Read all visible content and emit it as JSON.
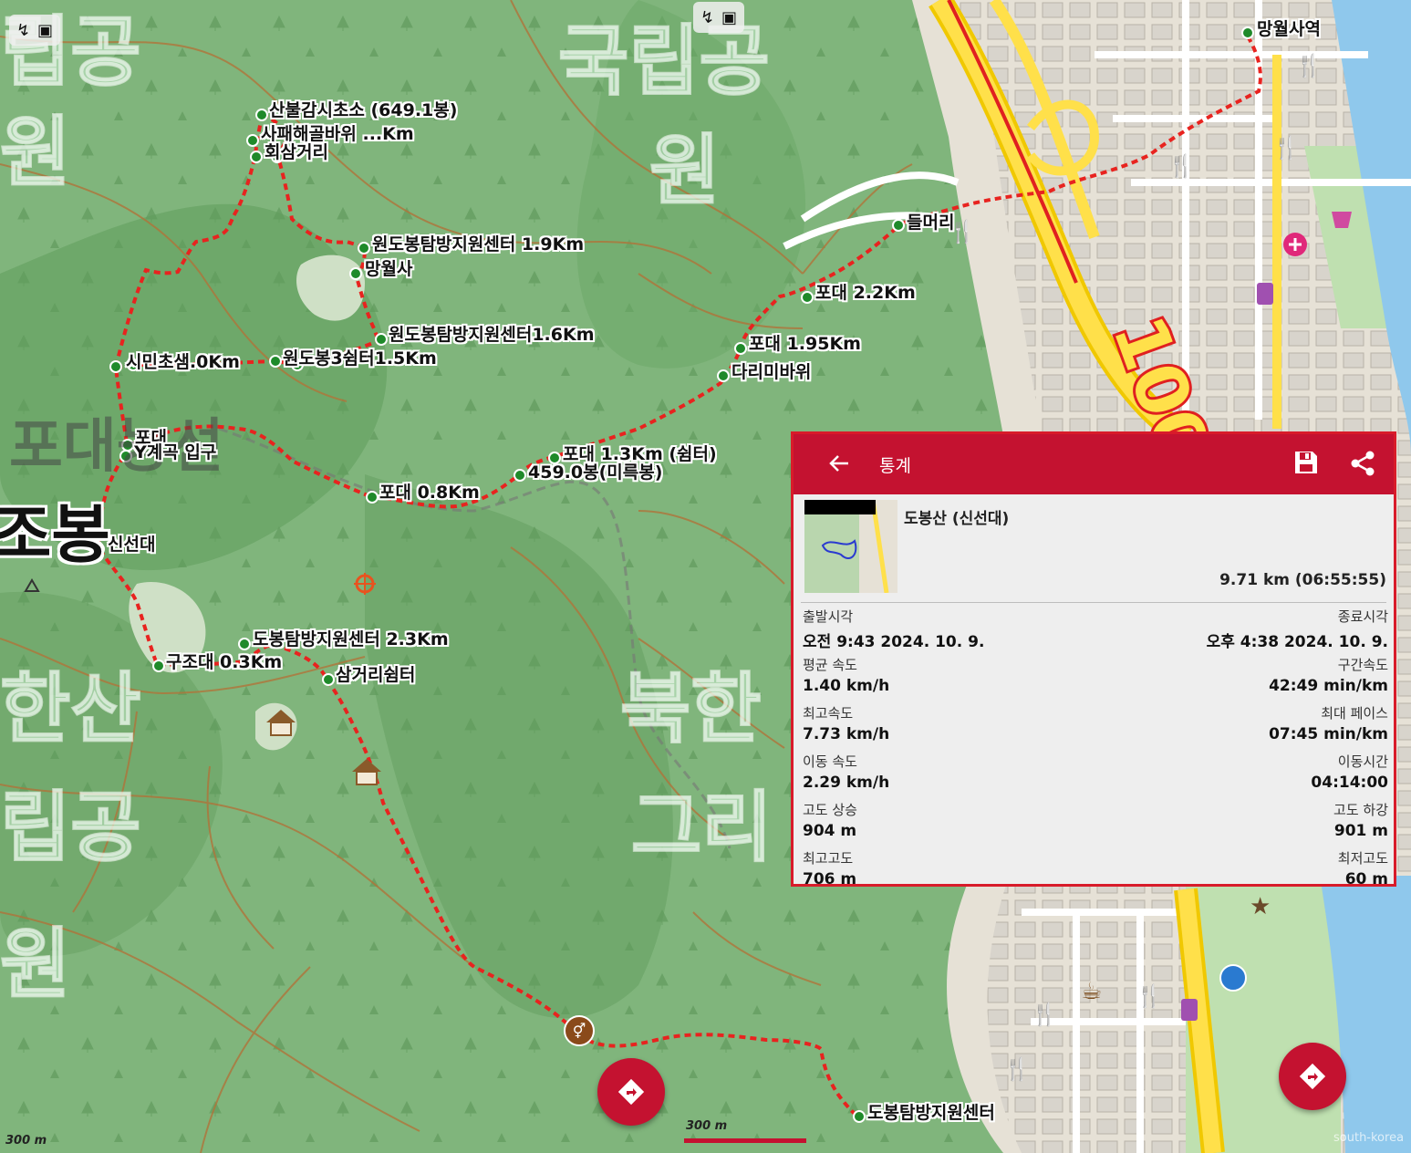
{
  "map": {
    "park_labels": [
      "국립공원",
      "립공",
      "원",
      "국립공",
      "원",
      "한산",
      "립공",
      "원",
      "북한",
      "그리"
    ],
    "area_labels": [
      "포대능선"
    ],
    "peak_labels": [
      "조봉"
    ],
    "road_number": "100",
    "scale_left": "300 m",
    "scale_center": "300 m",
    "attribution": "south-korea"
  },
  "waypoints": [
    "산불감시초소 (649.1봉)",
    "사패해골바위 ...Km",
    "회삼거리",
    "원도봉탐방지원센터 1.9Km",
    "망월사",
    "원도봉탐방지원센터1.6Km",
    "원도봉3쉼터1.5Km",
    "시민초샘.0Km",
    "포대",
    "Y계곡 입구",
    "포대 0.8Km",
    "포대 1.3Km (쉼터)",
    "459.0봉(미륵봉)",
    "신선대",
    "구조대 0.3Km",
    "도봉탐방지원센터 2.3Km",
    "삼거리쉼터",
    "들머리",
    "포대 2.2Km",
    "포대 1.95Km",
    "다리미바위",
    "망월사역",
    "도봉탐방지원센터"
  ],
  "stats": {
    "title": "통계",
    "track_name": "도봉산 (신선대)",
    "summary": "9.71 km (06:55:55)",
    "rows": [
      {
        "left_label": "출발시각",
        "left_value": "오전 9:43 2024. 10. 9.",
        "right_label": "종료시각",
        "right_value": "오후 4:38 2024. 10. 9."
      },
      {
        "left_label": "평균 속도",
        "left_value": "1.40 km/h",
        "right_label": "구간속도",
        "right_value": "42:49 min/km"
      },
      {
        "left_label": "최고속도",
        "left_value": "7.73 km/h",
        "right_label": "최대 페이스",
        "right_value": "07:45 min/km"
      },
      {
        "left_label": "이동 속도",
        "left_value": "2.29 km/h",
        "right_label": "이동시간",
        "right_value": "04:14:00"
      },
      {
        "left_label": "고도 상승",
        "left_value": "904 m",
        "right_label": "고도 하강",
        "right_value": "901 m"
      },
      {
        "left_label": "최고고도",
        "left_value": "706 m",
        "right_label": "최저고도",
        "right_value": "60 m"
      }
    ]
  },
  "colors": {
    "accent": "#c41230",
    "track": "#e8231f",
    "forest": "#7fb27a",
    "waypoint": "#1f8a2a"
  },
  "icons": [
    "back-arrow-icon",
    "save-icon",
    "share-icon",
    "navigate-icon",
    "gps-lock-icon",
    "layers-icon",
    "restaurant-icon",
    "cafe-icon",
    "shelter-icon",
    "toilet-icon",
    "gas-station-icon",
    "hospital-icon",
    "shopping-icon",
    "subway-icon",
    "target-icon",
    "star-icon",
    "peak-icon"
  ]
}
